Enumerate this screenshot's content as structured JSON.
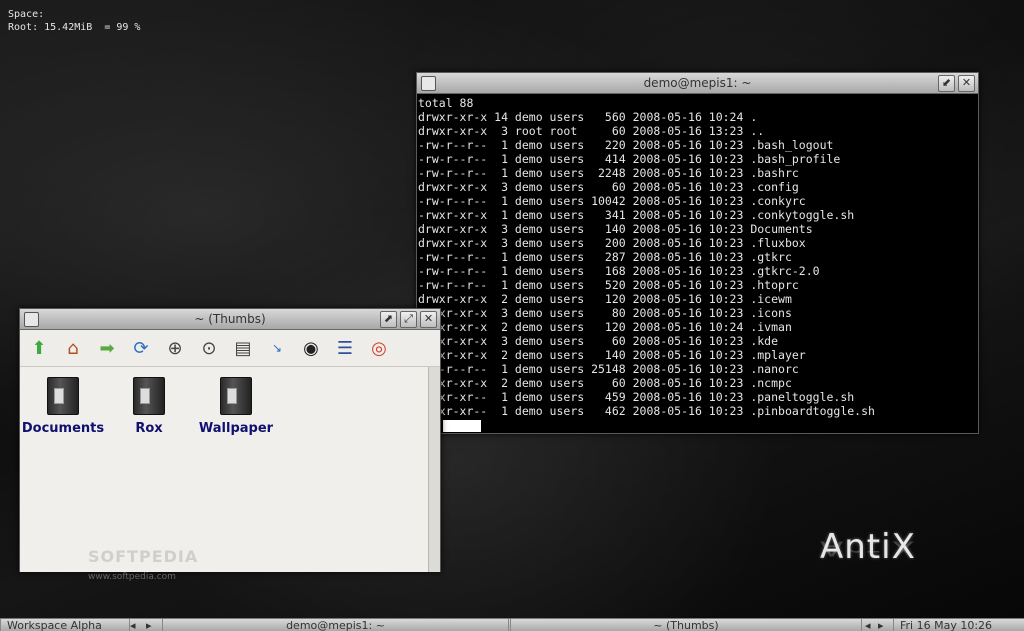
{
  "conky": {
    "space_label": "Space:",
    "root_line": "Root: 15.42MiB  = 99 %"
  },
  "terminal": {
    "title": "demo@mepis1: ~",
    "lines": [
      "total 88",
      "drwxr-xr-x 14 demo users   560 2008-05-16 10:24 .",
      "drwxr-xr-x  3 root root     60 2008-05-16 13:23 ..",
      "-rw-r--r--  1 demo users   220 2008-05-16 10:23 .bash_logout",
      "-rw-r--r--  1 demo users   414 2008-05-16 10:23 .bash_profile",
      "-rw-r--r--  1 demo users  2248 2008-05-16 10:23 .bashrc",
      "drwxr-xr-x  3 demo users    60 2008-05-16 10:23 .config",
      "-rw-r--r--  1 demo users 10042 2008-05-16 10:23 .conkyrc",
      "-rwxr-xr-x  1 demo users   341 2008-05-16 10:23 .conkytoggle.sh",
      "drwxr-xr-x  3 demo users   140 2008-05-16 10:23 Documents",
      "drwxr-xr-x  3 demo users   200 2008-05-16 10:23 .fluxbox",
      "-rw-r--r--  1 demo users   287 2008-05-16 10:23 .gtkrc",
      "-rw-r--r--  1 demo users   168 2008-05-16 10:23 .gtkrc-2.0",
      "-rw-r--r--  1 demo users   520 2008-05-16 10:23 .htoprc",
      "drwxr-xr-x  2 demo users   120 2008-05-16 10:23 .icewm",
      "drwxr-xr-x  3 demo users    80 2008-05-16 10:23 .icons",
      "drwxr-xr-x  2 demo users   120 2008-05-16 10:24 .ivman",
      "drwxr-xr-x  3 demo users    60 2008-05-16 10:23 .kde",
      "drwxr-xr-x  2 demo users   140 2008-05-16 10:23 .mplayer",
      "-rw-r--r--  1 demo users 25148 2008-05-16 10:23 .nanorc",
      "drwxr-xr-x  2 demo users    60 2008-05-16 10:23 .ncmpc",
      "-rwxr-xr--  1 demo users   459 2008-05-16 10:23 .paneltoggle.sh",
      "-rwxr-xr--  1 demo users   462 2008-05-16 10:23 .pinboardtoggle.sh"
    ]
  },
  "rox": {
    "title": "~ (Thumbs)",
    "files": [
      {
        "name": "Documents"
      },
      {
        "name": "Rox"
      },
      {
        "name": "Wallpaper"
      }
    ],
    "watermark": "SOFTPEDIA",
    "watermark_url": "www.softpedia.com"
  },
  "logo": "AntiX",
  "taskbar": {
    "workspace": "Workspace Alpha",
    "task1": "demo@mepis1: ~",
    "task2": "~ (Thumbs)",
    "clock": "Fri 16 May   10:26"
  },
  "icons": [
    "up-arrow-icon",
    "home-icon",
    "go-icon",
    "refresh-icon",
    "zoom-in-icon",
    "zoom-fit-icon",
    "details-icon",
    "sort-icon",
    "eye-icon",
    "list-icon",
    "help-icon"
  ]
}
